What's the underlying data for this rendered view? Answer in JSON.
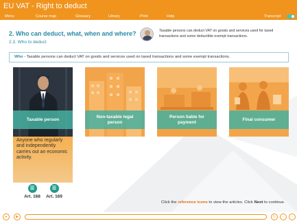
{
  "app": {
    "title": "EU VAT - Right to deduct"
  },
  "menu": {
    "menu": "Menu",
    "course_map": "Course map",
    "glossary": "Glossary",
    "library": "Library",
    "print": "Print",
    "help": "Help",
    "transcript": "Transcript"
  },
  "transcript_toggle": {
    "state": "on"
  },
  "heading": {
    "title": "2. Who can deduct, what, when and where?",
    "subtitle": "2.3. Who to deduct"
  },
  "callout": {
    "text": "Taxable persons can deduct VAT on goods and services used for taxed transactions and some deductible exempt transactions."
  },
  "banner": {
    "keyword": "Who",
    "text": " - Taxable persons can deduct VAT on goods and services used on taxed transactions and some exempt transactions."
  },
  "cards": [
    {
      "label": "Taxable person"
    },
    {
      "label": "Non-taxable legal person"
    },
    {
      "label": "Person liable for payment"
    },
    {
      "label": "Final consumer"
    }
  ],
  "description": {
    "text": "Anyone who regularly and independently carries out an economic activity."
  },
  "articles": [
    {
      "label": "Art. 168"
    },
    {
      "label": "Art. 169"
    }
  ],
  "hint": {
    "p1": "Click the ",
    "p2": "reference icons",
    "p3": " to view the articles. Click ",
    "p4": "Next",
    "p5": " to continue."
  },
  "colors": {
    "brand": "#f0941e",
    "accent": "#2a8aa6",
    "teal": "#46b0a0"
  },
  "icons": {
    "volume": "speaker-icon",
    "play": "play-icon",
    "replay": "replay-icon",
    "prev": "chevron-left-icon",
    "next": "chevron-right-icon",
    "article": "book-icon"
  }
}
